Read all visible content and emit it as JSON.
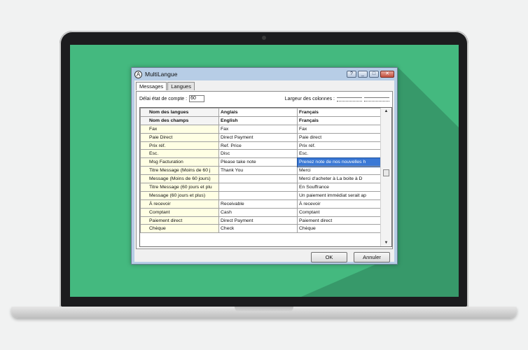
{
  "window": {
    "title": "MultiLangue",
    "help": "?",
    "min": "_",
    "max": "□",
    "close": "✕"
  },
  "tabs": [
    {
      "label": "Messages"
    },
    {
      "label": "Langues"
    }
  ],
  "options": {
    "delai_label": "Délai état de compte :",
    "delai_value": "60",
    "columns_label": "Largeur des colonnes :"
  },
  "grid": {
    "header_rows": [
      [
        "Nom des langues",
        "Anglais",
        "Français"
      ],
      [
        "Nom des champs",
        "English",
        "Français"
      ]
    ],
    "rows": [
      [
        "Fax",
        "Fax",
        "Fax"
      ],
      [
        "Paie Direct",
        "Direct Payment",
        "Paie direct"
      ],
      [
        "Prix réf.",
        "Ref. Price",
        "Prix réf."
      ],
      [
        "Esc.",
        "Disc",
        "Esc."
      ],
      [
        "Msg Facturation",
        "Please take note",
        "Prenez note de nos nouvelles h"
      ],
      [
        "Titre Message (Moins de 60 j",
        "Thank You",
        "Merci"
      ],
      [
        "Message (Moins de 60 jours)",
        "",
        "Merci d'acheter à La boite à D"
      ],
      [
        "Titre Message (60 jours et plu",
        "",
        "En Souffrance"
      ],
      [
        "Message (60 jours et plus)",
        "",
        "Un paiement immédiat serait ap"
      ],
      [
        "À recevoir",
        "Receivable",
        "À recevoir"
      ],
      [
        "Comptant",
        "Cash",
        "Comptant"
      ],
      [
        "Paiement direct",
        "Direct Payment",
        "Paiement direct"
      ],
      [
        "Chèque",
        "Check",
        "Chèque"
      ]
    ],
    "selected_cell": {
      "row": 4,
      "col": 2
    },
    "scroll_up": "▲",
    "scroll_down": "▼"
  },
  "buttons": {
    "ok": "OK",
    "cancel": "Annuler"
  },
  "colors": {
    "desktop": "#44b97f",
    "field_column": "#ffffe4",
    "selection": "#3b79d6"
  }
}
